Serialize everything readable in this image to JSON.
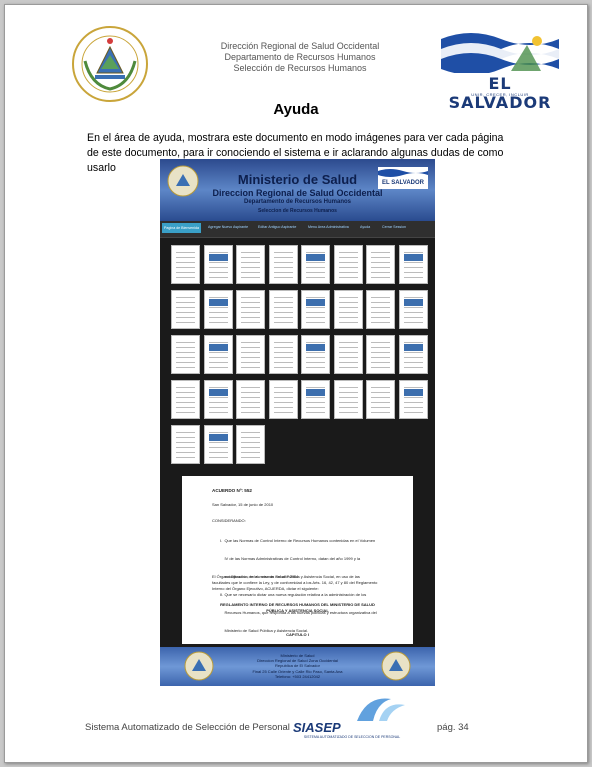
{
  "header": {
    "lines": [
      "Dirección Regional de Salud Occidental",
      "Departamento de Recursos Humanos",
      "Selección de Recursos Humanos"
    ],
    "right_logo_name": "EL SALVADOR",
    "right_logo_sub": "UNIR, CRECER, INCLUIR"
  },
  "title": "Ayuda",
  "paragraph": "En el área de ayuda, mostrara este documento en modo imágenes para ver cada página de este documento, para ir conociendo el sistema e ir aclarando algunas dudas de como usarlo",
  "screenshot": {
    "banner": {
      "line1": "Ministerio de Salud",
      "line2": "Direccion Regional de Salud Occidental",
      "line3": "Departamento de Recursos Humanos",
      "line4": "Seleccion de Recursos Humanos",
      "badge": "EL SALVADOR"
    },
    "nav": [
      "Pagina de Bienvenida",
      "Agregar Nuevo Aspirante",
      "Editar Antiguo Aspirante",
      "Menu Area Administrativa",
      "Ayuda",
      "Cerrar Session"
    ],
    "doc": {
      "heading": "ACUERDO Nº: 552",
      "date": "San Salvador, 15 de junio de 2010",
      "considerando": "CONSIDERANDO:",
      "items": [
        "I.  Que las Normas de Control Interno de Recursos Humanos contenidas en el Volumen",
        "    IV de las Normas Administrativas de Control Interno, datan del año 1999 y la",
        "    actualización de las mismas del año 2004.",
        "II. Que se necesario dictar una nueva regulación relativa a la administración de los",
        "    Recursos Humanos, que responda a las nuevas políticas y estructura organizativa del",
        "    Ministerio de Salud Pública y Asistencia Social."
      ],
      "body": [
        "El Órgano Ejecutivo, en el ramo de Salud Pública y Asistencia Social, en uso de las",
        "facultades que le confiere la Ley, y de conformidad a los Arts. 16, 42, 47 y 80 del Reglamento",
        "Interno del Órgano Ejecutivo, ACUERDA, dictar el siguiente:"
      ],
      "reglamento1": "REGLAMENTO INTERNO DE RECURSOS HUMANOS DEL MINISTERIO DE SALUD",
      "reglamento2": "PÚBLICA Y ASISTENCIA SOCIAL",
      "capitulo": "CAPITULO I"
    },
    "footer": [
      "Ministerio de Salud",
      "Direccion Regional de Salud Zona Occidental",
      "Republica de El Salvador",
      "Final 25 Calle Oriente y Calle Rio Paso, Santa Ana",
      "Telefono: +503 24412042"
    ]
  },
  "footer": {
    "left": "Sistema Automatizado de Selección de Personal",
    "logo_name": "SIASEP",
    "logo_sub": "SISTEMA AUTOMATIZADO DE SELECCION DE PERSONAL",
    "page": "pág. 34"
  }
}
